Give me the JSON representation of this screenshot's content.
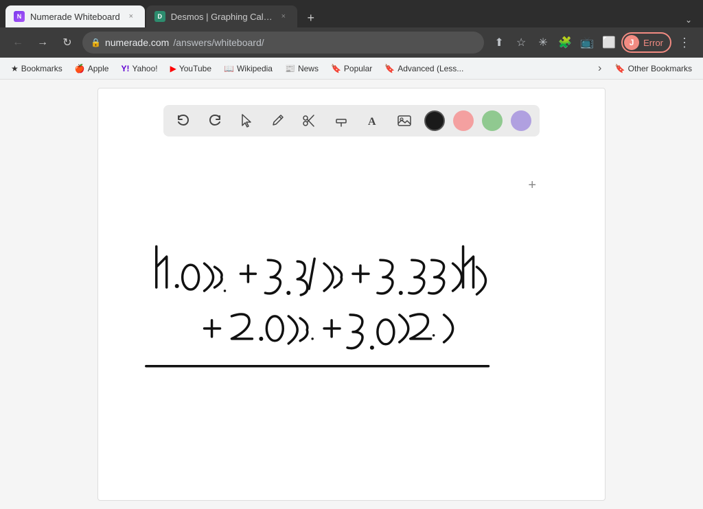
{
  "browser": {
    "tabs": [
      {
        "id": "tab-numerade",
        "favicon_label": "N",
        "favicon_color": "#7c3aed",
        "title": "Numerade Whiteboard",
        "active": true
      },
      {
        "id": "tab-desmos",
        "favicon_label": "D",
        "favicon_color": "#2d8c6e",
        "title": "Desmos | Graphing Calculat...",
        "active": false
      }
    ],
    "new_tab_label": "+",
    "expand_label": "⌄",
    "address": {
      "url_base": "numerade.com",
      "url_path": "/answers/whiteboard/",
      "full": "numerade.com/answers/whiteboard/"
    },
    "profile": {
      "initial": "J",
      "status": "Error"
    }
  },
  "bookmarks": [
    {
      "id": "bm-bookmarks",
      "icon": "★",
      "label": "Bookmarks"
    },
    {
      "id": "bm-apple",
      "icon": "🍎",
      "label": "Apple"
    },
    {
      "id": "bm-yahoo",
      "icon": "Y!",
      "label": "Yahoo!"
    },
    {
      "id": "bm-youtube",
      "icon": "▶",
      "label": "YouTube"
    },
    {
      "id": "bm-wikipedia",
      "icon": "W",
      "label": "Wikipedia"
    },
    {
      "id": "bm-news",
      "icon": "📰",
      "label": "News"
    },
    {
      "id": "bm-popular",
      "icon": "🔖",
      "label": "Popular"
    },
    {
      "id": "bm-advanced",
      "icon": "🔖",
      "label": "Advanced (Less..."
    }
  ],
  "bookmarks_other": {
    "icon": "🔖",
    "label": "Other Bookmarks"
  },
  "whiteboard": {
    "toolbar": {
      "tools": [
        {
          "id": "undo",
          "symbol": "↩",
          "label": "Undo"
        },
        {
          "id": "redo",
          "symbol": "↪",
          "label": "Redo"
        },
        {
          "id": "select",
          "symbol": "⬆",
          "label": "Select"
        },
        {
          "id": "pencil",
          "symbol": "✏",
          "label": "Pencil"
        },
        {
          "id": "tools",
          "symbol": "✂",
          "label": "Tools"
        },
        {
          "id": "highlighter",
          "symbol": "▬",
          "label": "Highlighter"
        },
        {
          "id": "text",
          "symbol": "A",
          "label": "Text"
        },
        {
          "id": "image",
          "symbol": "🖼",
          "label": "Image"
        }
      ],
      "colors": [
        {
          "id": "color-black",
          "value": "#1a1a1a",
          "active": true
        },
        {
          "id": "color-pink",
          "value": "#f4a0a0"
        },
        {
          "id": "color-green",
          "value": "#90c990"
        },
        {
          "id": "color-purple",
          "value": "#b0a0e0"
        }
      ]
    },
    "plus_crosshair": "+",
    "equation_line1": "4.0(3) + 3.67(3) + 3.33(4)",
    "equation_line2": "+ 2.0 (3) + 3.0(2)"
  }
}
